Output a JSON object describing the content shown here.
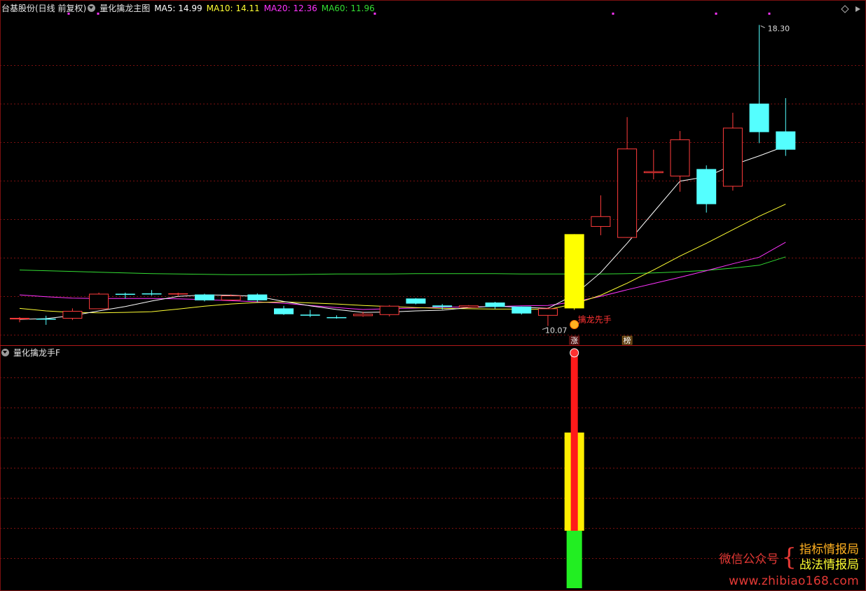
{
  "header": {
    "title": "台基股份(日线 前复权)",
    "indicator": "量化擒龙主图",
    "ma_labels": [
      {
        "text": "MA5: 14.99",
        "color": "#ffffff"
      },
      {
        "text": "MA10: 14.11",
        "color": "#ffff33"
      },
      {
        "text": "MA20: 12.36",
        "color": "#ff33ff"
      },
      {
        "text": "MA60: 11.96",
        "color": "#33dd33"
      }
    ]
  },
  "subpanel": {
    "title": "量化擒龙手F"
  },
  "annotations": {
    "high_label": "18.30",
    "low_label": "10.07",
    "signal_text": "擒龙先手",
    "zhang_badge": "涨",
    "bang_badge": "榜"
  },
  "watermark": {
    "left": "微信公众号",
    "right1": "指标情报局",
    "right2": "战法情报局",
    "url": "www.zhibiao168.com"
  },
  "colors": {
    "up": "#ff3b3b",
    "down": "#54ffff",
    "ma5": "#ffffff",
    "ma10": "#ffff33",
    "ma20": "#ff33ff",
    "ma60": "#33dd33",
    "signal_bar": "#ffff00",
    "grid": "#7a1010"
  },
  "chart_data": {
    "type": "candlestick",
    "ylim": [
      9.6,
      18.6
    ],
    "candles": [
      {
        "o": 10.25,
        "c": 10.29,
        "h": 10.31,
        "l": 10.17
      },
      {
        "o": 10.27,
        "c": 10.25,
        "h": 10.35,
        "l": 10.1
      },
      {
        "o": 10.27,
        "c": 10.48,
        "h": 10.55,
        "l": 10.23
      },
      {
        "o": 10.53,
        "c": 10.95,
        "h": 10.98,
        "l": 10.53
      },
      {
        "o": 10.95,
        "c": 10.92,
        "h": 10.98,
        "l": 10.82
      },
      {
        "o": 10.96,
        "c": 10.94,
        "h": 11.05,
        "l": 10.9
      },
      {
        "o": 10.94,
        "c": 10.96,
        "h": 10.98,
        "l": 10.88
      },
      {
        "o": 10.93,
        "c": 10.77,
        "h": 10.95,
        "l": 10.74
      },
      {
        "o": 10.77,
        "c": 10.9,
        "h": 10.93,
        "l": 10.76
      },
      {
        "o": 10.93,
        "c": 10.77,
        "h": 10.96,
        "l": 10.72
      },
      {
        "o": 10.55,
        "c": 10.39,
        "h": 10.62,
        "l": 10.37
      },
      {
        "o": 10.38,
        "c": 10.35,
        "h": 10.51,
        "l": 10.31
      },
      {
        "o": 10.31,
        "c": 10.29,
        "h": 10.36,
        "l": 10.27
      },
      {
        "o": 10.34,
        "c": 10.4,
        "h": 10.46,
        "l": 10.32
      },
      {
        "o": 10.37,
        "c": 10.62,
        "h": 10.64,
        "l": 10.33
      },
      {
        "o": 10.82,
        "c": 10.68,
        "h": 10.83,
        "l": 10.66
      },
      {
        "o": 10.63,
        "c": 10.59,
        "h": 10.67,
        "l": 10.52
      },
      {
        "o": 10.57,
        "c": 10.63,
        "h": 10.64,
        "l": 10.56
      },
      {
        "o": 10.71,
        "c": 10.59,
        "h": 10.73,
        "l": 10.54
      },
      {
        "o": 10.6,
        "c": 10.41,
        "h": 10.6,
        "l": 10.38
      },
      {
        "o": 10.35,
        "c": 10.55,
        "h": 10.58,
        "l": 10.07
      },
      {
        "o": 10.55,
        "c": 12.58,
        "h": 12.58,
        "l": 10.51
      },
      {
        "o": 12.78,
        "c": 13.07,
        "h": 13.64,
        "l": 12.55
      },
      {
        "o": 12.48,
        "c": 14.92,
        "h": 15.78,
        "l": 12.48
      },
      {
        "o": 14.25,
        "c": 14.3,
        "h": 14.89,
        "l": 14.08
      },
      {
        "o": 14.16,
        "c": 15.17,
        "h": 15.4,
        "l": 13.74
      },
      {
        "o": 14.36,
        "c": 13.4,
        "h": 14.46,
        "l": 13.17
      },
      {
        "o": 13.88,
        "c": 15.49,
        "h": 15.9,
        "l": 13.77
      },
      {
        "o": 16.15,
        "c": 15.37,
        "h": 18.3,
        "l": 15.07
      },
      {
        "o": 15.39,
        "c": 14.89,
        "h": 16.3,
        "l": 14.72
      }
    ],
    "ma5": [
      10.25,
      10.27,
      10.35,
      10.48,
      10.6,
      10.75,
      10.88,
      10.92,
      10.91,
      10.88,
      10.74,
      10.62,
      10.52,
      10.44,
      10.45,
      10.48,
      10.5,
      10.57,
      10.61,
      10.58,
      10.55,
      10.92,
      11.53,
      12.33,
      13.18,
      14.03,
      14.15,
      14.47,
      14.72,
      14.99
    ],
    "ma10": [
      10.55,
      10.48,
      10.44,
      10.43,
      10.44,
      10.46,
      10.53,
      10.61,
      10.67,
      10.71,
      10.73,
      10.7,
      10.67,
      10.63,
      10.6,
      10.57,
      10.55,
      10.54,
      10.53,
      10.53,
      10.52,
      10.67,
      10.91,
      11.24,
      11.6,
      11.98,
      12.33,
      12.7,
      13.07,
      13.4
    ],
    "ma20": [
      10.92,
      10.87,
      10.83,
      10.82,
      10.82,
      10.82,
      10.81,
      10.79,
      10.76,
      10.73,
      10.69,
      10.63,
      10.57,
      10.52,
      10.54,
      10.56,
      10.58,
      10.59,
      10.6,
      10.62,
      10.63,
      10.73,
      10.88,
      11.06,
      11.23,
      11.4,
      11.58,
      11.77,
      11.95,
      12.36
    ],
    "ma60": [
      11.6,
      11.58,
      11.56,
      11.54,
      11.52,
      11.5,
      11.49,
      11.48,
      11.47,
      11.47,
      11.47,
      11.48,
      11.49,
      11.49,
      11.49,
      11.5,
      11.5,
      11.5,
      11.5,
      11.49,
      11.49,
      11.49,
      11.49,
      11.5,
      11.52,
      11.55,
      11.59,
      11.65,
      11.73,
      11.96
    ],
    "signal_index": 21,
    "sub": {
      "ylim": [
        0,
        10
      ],
      "index": 21,
      "green": [
        0,
        2.4
      ],
      "yellow": [
        2.4,
        6.5
      ],
      "red": [
        2.4,
        9.8
      ]
    }
  }
}
